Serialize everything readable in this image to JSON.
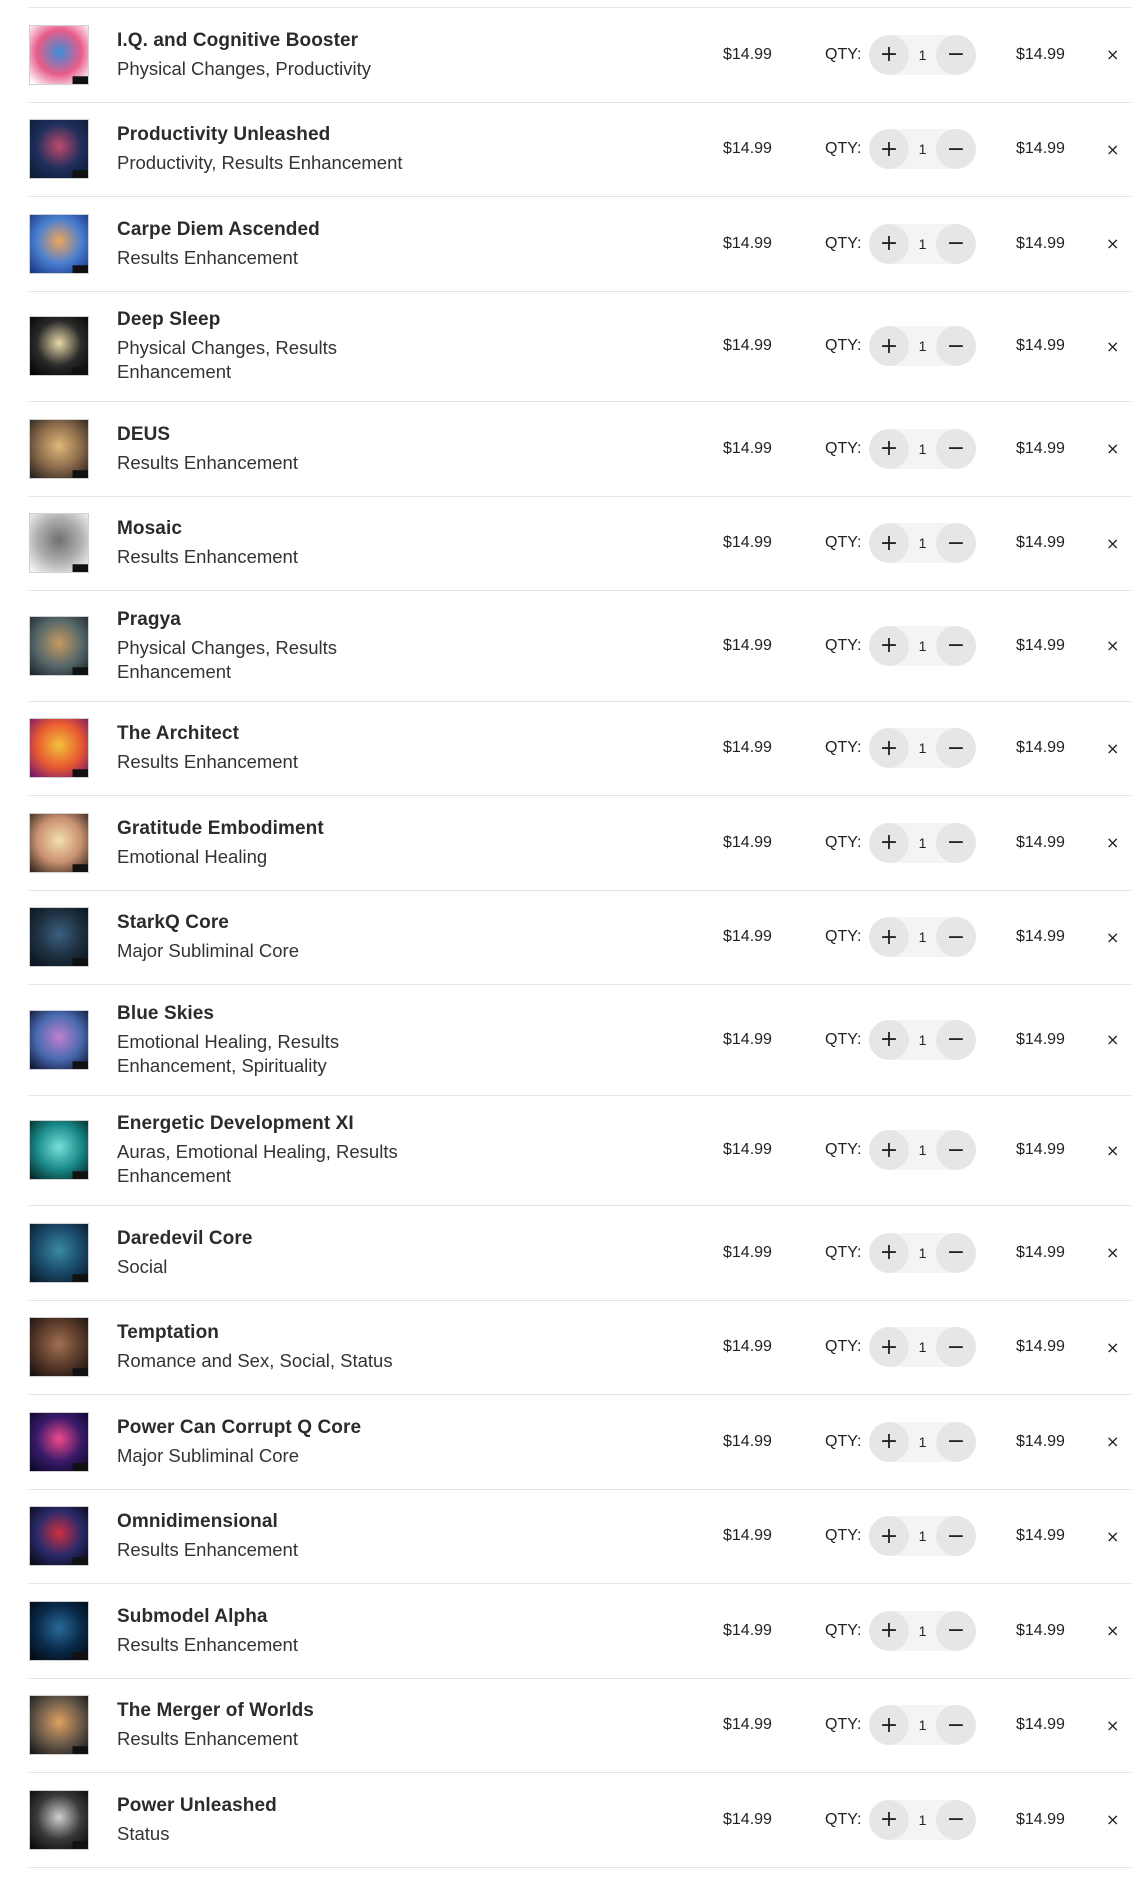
{
  "cart": {
    "qty_label": "QTY:",
    "plus_symbol": "+",
    "minus_symbol": "−",
    "remove_symbol": "×",
    "items": [
      {
        "title": "I.Q. and Cognitive Booster",
        "categories": "Physical Changes, Productivity",
        "price": "$14.99",
        "qty": "1",
        "subtotal": "$14.99",
        "image_icon": "brain-image",
        "colors": [
          "#ffffff",
          "#e85c8a",
          "#3b8fd8"
        ]
      },
      {
        "title": "Productivity Unleashed",
        "categories": "Productivity, Results Enhancement",
        "price": "$14.99",
        "qty": "1",
        "subtotal": "$14.99",
        "image_icon": "circuit-image",
        "colors": [
          "#0d1a36",
          "#1f2f5c",
          "#c04a6a"
        ]
      },
      {
        "title": "Carpe Diem Ascended",
        "categories": "Results Enhancement",
        "price": "$14.99",
        "qty": "1",
        "subtotal": "$14.99",
        "image_icon": "horizon-image",
        "colors": [
          "#1a3a8a",
          "#4a7fd0",
          "#f2a65a"
        ]
      },
      {
        "title": "Deep Sleep",
        "categories": "Physical Changes, Results Enhancement",
        "price": "$14.99",
        "qty": "1",
        "subtotal": "$14.99",
        "image_icon": "moon-image",
        "colors": [
          "#050505",
          "#2a2a2a",
          "#e8d9a8"
        ]
      },
      {
        "title": "DEUS",
        "categories": "Results Enhancement",
        "price": "$14.99",
        "qty": "1",
        "subtotal": "$14.99",
        "image_icon": "sky-image",
        "colors": [
          "#2a2420",
          "#8a6a4a",
          "#e0b878"
        ]
      },
      {
        "title": "Mosaic",
        "categories": "Results Enhancement",
        "price": "$14.99",
        "qty": "1",
        "subtotal": "$14.99",
        "image_icon": "sketch-image",
        "colors": [
          "#f4f4f4",
          "#b0b0b0",
          "#707070"
        ]
      },
      {
        "title": "Pragya",
        "categories": "Physical Changes, Results Enhancement",
        "price": "$14.99",
        "qty": "1",
        "subtotal": "$14.99",
        "image_icon": "ship-image",
        "colors": [
          "#1e2a34",
          "#5a6a6a",
          "#c89a60"
        ]
      },
      {
        "title": "The Architect",
        "categories": "Results Enhancement",
        "price": "$14.99",
        "qty": "1",
        "subtotal": "$14.99",
        "image_icon": "swirl-image",
        "colors": [
          "#7a1a6a",
          "#e85a30",
          "#f2c23a"
        ]
      },
      {
        "title": "Gratitude Embodiment",
        "categories": "Emotional Healing",
        "price": "$14.99",
        "qty": "1",
        "subtotal": "$14.99",
        "image_icon": "hands-image",
        "colors": [
          "#3a2a22",
          "#c89070",
          "#f4e0b0"
        ]
      },
      {
        "title": "StarkQ Core",
        "categories": "Major Subliminal Core",
        "price": "$14.99",
        "qty": "1",
        "subtotal": "$14.99",
        "image_icon": "figure-image",
        "colors": [
          "#0a141e",
          "#1e3040",
          "#3a6080"
        ]
      },
      {
        "title": "Blue Skies",
        "categories": "Emotional Healing, Results Enhancement, Spirituality",
        "price": "$14.99",
        "qty": "1",
        "subtotal": "$14.99",
        "image_icon": "nebula-image",
        "colors": [
          "#101a3a",
          "#4a6ab0",
          "#c080d0"
        ]
      },
      {
        "title": "Energetic Development XI",
        "categories": "Auras, Emotional Healing, Results Enhancement",
        "price": "$14.99",
        "qty": "1",
        "subtotal": "$14.99",
        "image_icon": "aura-image",
        "colors": [
          "#062a2a",
          "#1a8a8a",
          "#7ae0d8"
        ]
      },
      {
        "title": "Daredevil Core",
        "categories": "Social",
        "price": "$14.99",
        "qty": "1",
        "subtotal": "$14.99",
        "image_icon": "diver-image",
        "colors": [
          "#0a1a2a",
          "#1a4a6a",
          "#3a8aa0"
        ]
      },
      {
        "title": "Temptation",
        "categories": "Romance and Sex, Social, Status",
        "price": "$14.99",
        "qty": "1",
        "subtotal": "$14.99",
        "image_icon": "couple-image",
        "colors": [
          "#1a1210",
          "#5a3a2a",
          "#a07050"
        ]
      },
      {
        "title": "Power Can Corrupt Q Core",
        "categories": "Major Subliminal Core",
        "price": "$14.99",
        "qty": "1",
        "subtotal": "$14.99",
        "image_icon": "orb-image",
        "colors": [
          "#0a0a2a",
          "#3a1a6a",
          "#f04a8a"
        ]
      },
      {
        "title": "Omnidimensional",
        "categories": "Results Enhancement",
        "price": "$14.99",
        "qty": "1",
        "subtotal": "$14.99",
        "image_icon": "triangle-image",
        "colors": [
          "#0a0a1a",
          "#2a2a6a",
          "#d03040"
        ]
      },
      {
        "title": "Submodel Alpha",
        "categories": "Results Enhancement",
        "price": "$14.99",
        "qty": "1",
        "subtotal": "$14.99",
        "image_icon": "globe-image",
        "colors": [
          "#020a14",
          "#0a2a4a",
          "#2a6a9a"
        ]
      },
      {
        "title": "The Merger of Worlds",
        "categories": "Results Enhancement",
        "price": "$14.99",
        "qty": "1",
        "subtotal": "$14.99",
        "image_icon": "planet-image",
        "colors": [
          "#1a1a1a",
          "#6a5a4a",
          "#e0a060"
        ]
      },
      {
        "title": "Power Unleashed",
        "categories": "Status",
        "price": "$14.99",
        "qty": "1",
        "subtotal": "$14.99",
        "image_icon": "hand-image",
        "colors": [
          "#0a0a0a",
          "#3a3a3a",
          "#d0d0d0"
        ]
      }
    ]
  }
}
